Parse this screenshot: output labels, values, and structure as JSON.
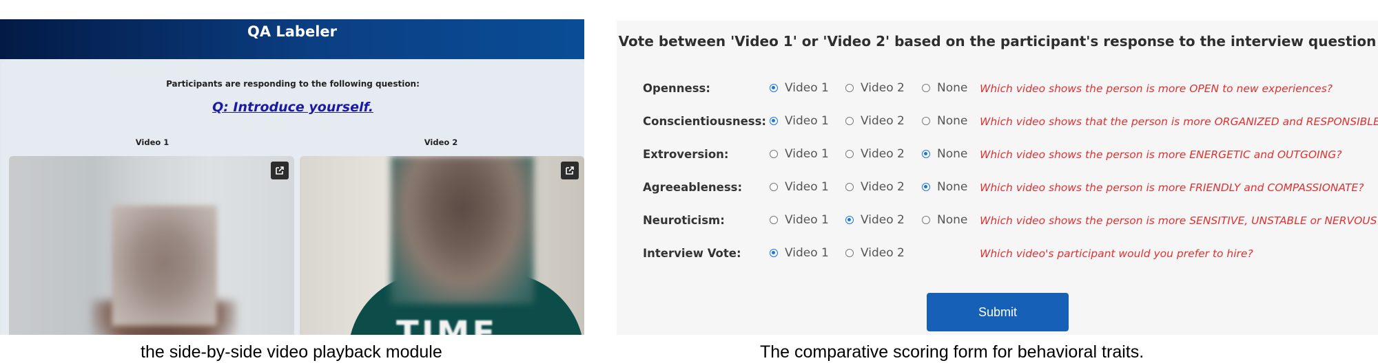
{
  "left_panel": {
    "header_title": "QA Labeler",
    "question_intro": "Participants are responding to the following question:",
    "question_text": "Q: Introduce yourself.",
    "videos": [
      {
        "label": "Video 1"
      },
      {
        "label": "Video 2"
      }
    ],
    "open_icon": "open-in-new-icon",
    "video2_shirt_print": "TIME"
  },
  "form": {
    "title": "Vote between 'Video 1' or 'Video 2' based on the participant's response to the interview question",
    "rows": [
      {
        "label": "Openness:",
        "options": [
          "Video 1",
          "Video 2",
          "None"
        ],
        "selected": "Video 1",
        "hint": "Which video shows the person is more OPEN to new experiences?"
      },
      {
        "label": "Conscientiousness:",
        "options": [
          "Video 1",
          "Video 2",
          "None"
        ],
        "selected": "Video 1",
        "hint": "Which video shows that the person is more ORGANIZED and RESPONSIBLE?"
      },
      {
        "label": "Extroversion:",
        "options": [
          "Video 1",
          "Video 2",
          "None"
        ],
        "selected": "None",
        "hint": "Which video shows the person is more ENERGETIC and OUTGOING?"
      },
      {
        "label": "Agreeableness:",
        "options": [
          "Video 1",
          "Video 2",
          "None"
        ],
        "selected": "None",
        "hint": "Which video shows the person is more FRIENDLY and COMPASSIONATE?"
      },
      {
        "label": "Neuroticism:",
        "options": [
          "Video 1",
          "Video 2",
          "None"
        ],
        "selected": "Video 2",
        "hint": "Which video shows the person is more SENSITIVE, UNSTABLE or NERVOUS?"
      },
      {
        "label": "Interview Vote:",
        "options": [
          "Video 1",
          "Video 2"
        ],
        "selected": "Video 1",
        "hint": "Which video's participant would you prefer to hire?"
      }
    ],
    "submit_label": "Submit"
  },
  "captions": {
    "left": "the side-by-side video playback module",
    "right": "The comparative scoring form for behavioral traits."
  },
  "colors": {
    "header_start": "#031a45",
    "header_end": "#0a4d96",
    "question_link": "#1a1aa6",
    "hint": "#e03131",
    "radio_selected": "#1a73e8",
    "submit": "#1660b8"
  }
}
